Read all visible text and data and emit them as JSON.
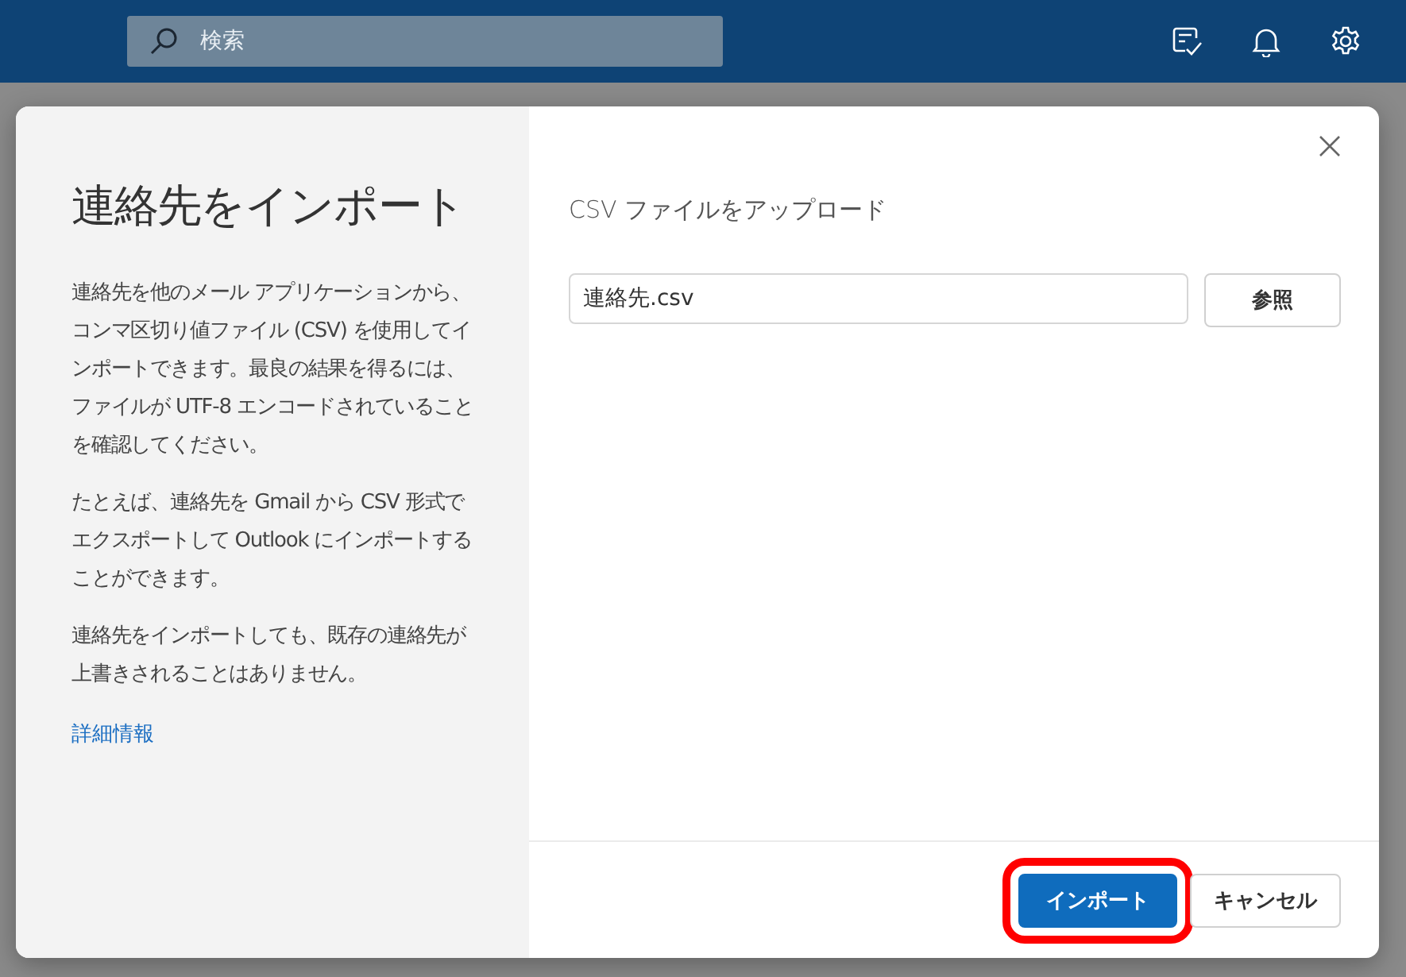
{
  "top_bar": {
    "search": {
      "placeholder": "検索"
    }
  },
  "dialog": {
    "title": "連絡先をインポート",
    "paragraphs": [
      "連絡先を他のメール アプリケーションから、コンマ区切り値ファイル (CSV) を使用してインポートできます。最良の結果を得るには、ファイルが UTF-8 エンコードされていることを確認してください。",
      "たとえば、連絡先を Gmail から CSV 形式でエクスポートして Outlook にインポートすることができます。",
      "連絡先をインポートしても、既存の連絡先が上書きされることはありません。"
    ],
    "link": "詳細情報",
    "upload_heading": "CSV ファイルをアップロード",
    "file_field": {
      "value": "連絡先.csv"
    },
    "browse_button": "参照",
    "buttons": [
      {
        "label": "インポート",
        "kind": "primary",
        "highlighted": true
      },
      {
        "label": "キャンセル",
        "kind": "secondary",
        "highlighted": false
      }
    ]
  }
}
